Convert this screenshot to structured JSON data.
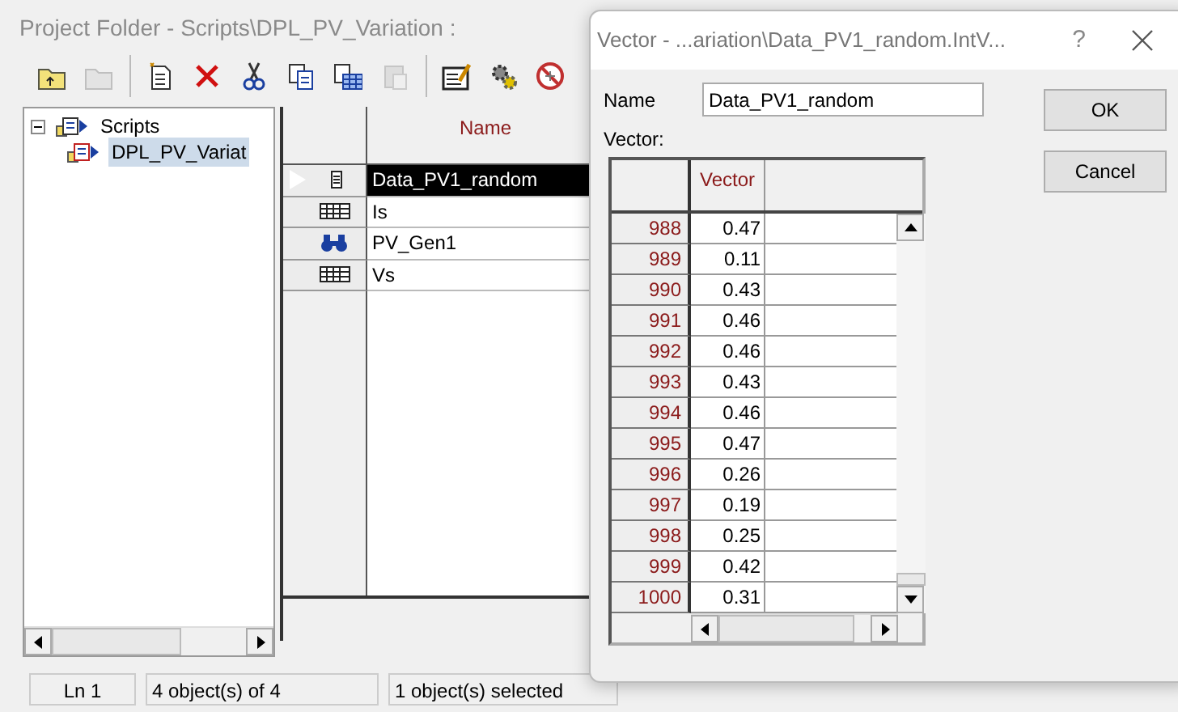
{
  "window": {
    "title": "Project Folder - Scripts\\DPL_PV_Variation :"
  },
  "toolbar": [
    {
      "kind": "folder-up",
      "disabled": false
    },
    {
      "kind": "folder",
      "disabled": true
    },
    {
      "kind": "new",
      "disabled": false
    },
    {
      "kind": "delete",
      "disabled": false
    },
    {
      "kind": "cut",
      "disabled": false
    },
    {
      "kind": "copy",
      "disabled": false
    },
    {
      "kind": "paste-table",
      "disabled": false
    },
    {
      "kind": "paste",
      "disabled": true
    },
    {
      "kind": "edit",
      "disabled": false
    },
    {
      "kind": "gears",
      "disabled": false
    },
    {
      "kind": "forbidden",
      "disabled": false
    }
  ],
  "tree": [
    {
      "label": "Scripts",
      "expanded": true,
      "selected": false,
      "children": [
        {
          "label": "DPL_PV_Variat",
          "selected": true
        }
      ]
    }
  ],
  "objects": {
    "columns": [
      "Name"
    ],
    "rows": [
      {
        "name": "Data_PV1_random",
        "kind": "vector",
        "selected": true
      },
      {
        "name": "Is",
        "kind": "matrix",
        "selected": false
      },
      {
        "name": "PV_Gen1",
        "kind": "generator",
        "selected": false
      },
      {
        "name": "Vs",
        "kind": "matrix",
        "selected": false
      }
    ]
  },
  "status_bar": [
    "Ln 1",
    "4 object(s) of 4",
    "1 object(s) selected"
  ],
  "dialog": {
    "title": "Vector - ...ariation\\Data_PV1_random.IntV...",
    "help": "?",
    "name_label": "Name",
    "name_value": "Data_PV1_random",
    "vector_label": "Vector:",
    "column": "Vector",
    "rows": [
      {
        "index": "988",
        "value": "0.47"
      },
      {
        "index": "989",
        "value": "0.11"
      },
      {
        "index": "990",
        "value": "0.43"
      },
      {
        "index": "991",
        "value": "0.46"
      },
      {
        "index": "992",
        "value": "0.46"
      },
      {
        "index": "993",
        "value": "0.43"
      },
      {
        "index": "994",
        "value": "0.46"
      },
      {
        "index": "995",
        "value": "0.47"
      },
      {
        "index": "996",
        "value": "0.26"
      },
      {
        "index": "997",
        "value": "0.19"
      },
      {
        "index": "998",
        "value": "0.25"
      },
      {
        "index": "999",
        "value": "0.42"
      },
      {
        "index": "1000",
        "value": "0.31"
      }
    ],
    "buttons": [
      "OK",
      "Cancel"
    ]
  }
}
